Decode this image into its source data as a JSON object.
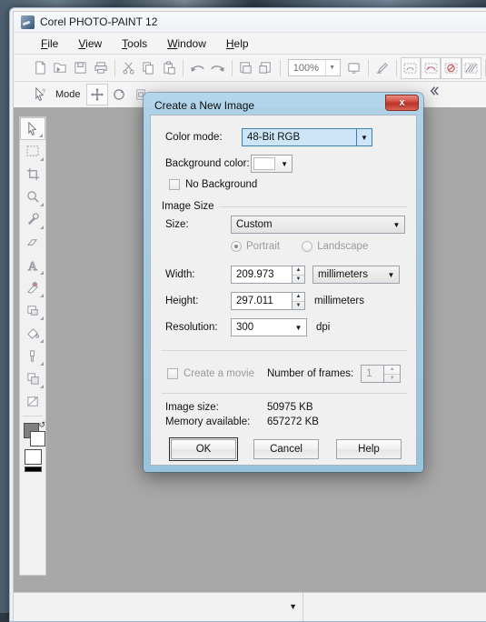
{
  "window": {
    "title": "Corel PHOTO-PAINT 12",
    "app_icon": "paintbrush-icon"
  },
  "menubar": {
    "items": [
      {
        "label": "File",
        "accel": "F"
      },
      {
        "label": "View",
        "accel": "V"
      },
      {
        "label": "Tools",
        "accel": "T"
      },
      {
        "label": "Window",
        "accel": "W"
      },
      {
        "label": "Help",
        "accel": "H"
      }
    ]
  },
  "toolbar": {
    "zoom_value": "100%",
    "buttons": [
      "new-icon",
      "open-icon",
      "save-icon",
      "print-icon",
      "cut-icon",
      "copy-icon",
      "paste-icon",
      "undo-icon",
      "redo-icon",
      "import-icon",
      "export-icon",
      "fullscreen-icon",
      "pickcolor-icon",
      "mask-marquee-icon",
      "mask-overlay-icon",
      "mask-remove-icon",
      "mask-transparency-icon"
    ]
  },
  "propertybar": {
    "mode_label": "Mode",
    "buttons": [
      "pick-tool-icon",
      "move-icon",
      "rotate-icon",
      "anchor-icon"
    ],
    "collapse_label": "«"
  },
  "toolbox": {
    "tools": [
      {
        "name": "pick-tool-icon",
        "selected": true
      },
      {
        "name": "mask-rectangle-icon",
        "selected": false
      },
      {
        "name": "crop-tool-icon",
        "selected": false
      },
      {
        "name": "zoom-tool-icon",
        "selected": false
      },
      {
        "name": "eyedropper-tool-icon",
        "selected": false
      },
      {
        "name": "eraser-tool-icon",
        "selected": false
      },
      {
        "name": "text-tool-icon",
        "selected": false
      },
      {
        "name": "clone-tool-icon",
        "selected": false
      },
      {
        "name": "rectangle-tool-icon",
        "selected": false
      },
      {
        "name": "fill-tool-icon",
        "selected": false
      },
      {
        "name": "paint-tool-icon",
        "selected": false
      },
      {
        "name": "shape-tool-icon",
        "selected": false
      },
      {
        "name": "effect-tool-icon",
        "selected": false
      }
    ],
    "colors": {
      "foreground": "#808080",
      "background": "#ffffff",
      "paper": "#ffffff",
      "strip": "#000000"
    }
  },
  "dialog": {
    "title": "Create a New Image",
    "close_label": "x",
    "color_mode": {
      "label": "Color mode:",
      "value": "48-Bit RGB",
      "focused": true
    },
    "background_color": {
      "label": "Background color:",
      "swatch": "#ffffff"
    },
    "no_background": {
      "label": "No Background",
      "checked": false
    },
    "image_size_group": {
      "title": "Image Size",
      "size": {
        "label": "Size:",
        "value": "Custom"
      },
      "orientation": {
        "portrait_label": "Portrait",
        "landscape_label": "Landscape",
        "selected": "Portrait",
        "disabled": true
      },
      "width": {
        "label": "Width:",
        "value": "209.973",
        "units": "millimeters"
      },
      "height": {
        "label": "Height:",
        "value": "297.011",
        "units": "millimeters"
      },
      "resolution": {
        "label": "Resolution:",
        "value": "300",
        "units": "dpi"
      }
    },
    "movie": {
      "create_label": "Create a movie",
      "checked": false,
      "disabled": true,
      "frames_label": "Number of frames:",
      "frames_value": "1"
    },
    "info": {
      "image_size_label": "Image size:",
      "image_size_value": "50975  KB",
      "memory_label": "Memory available:",
      "memory_value": "657272  KB"
    },
    "buttons": {
      "ok": "OK",
      "cancel": "Cancel",
      "help": "Help"
    }
  },
  "statusbar": {
    "dropdown_arrow": "▼"
  },
  "colors": {
    "accent": "#3c7fb1",
    "focus_fill": "#cde6f7",
    "close_red": "#bc3226",
    "canvas_grey": "#a8a8a8"
  }
}
